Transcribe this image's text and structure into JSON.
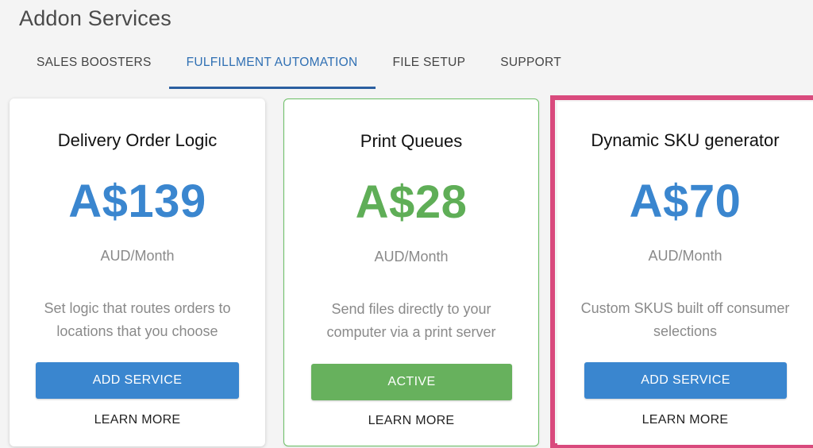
{
  "header": {
    "title": "Addon Services"
  },
  "tabs": [
    {
      "label": "SALES BOOSTERS",
      "active": false
    },
    {
      "label": "FULFILLMENT AUTOMATION",
      "active": true
    },
    {
      "label": "FILE SETUP",
      "active": false
    },
    {
      "label": "SUPPORT",
      "active": false
    }
  ],
  "cards": [
    {
      "title": "Delivery Order Logic",
      "price": "A$139",
      "unit": "AUD/Month",
      "description": "Set logic that routes orders to locations that you choose",
      "button_label": "ADD SERVICE",
      "learn_more": "LEARN MORE",
      "status": "available"
    },
    {
      "title": "Print Queues",
      "price": "A$28",
      "unit": "AUD/Month",
      "description": "Send files directly to your computer via a print server",
      "button_label": "ACTIVE",
      "learn_more": "LEARN MORE",
      "status": "active"
    },
    {
      "title": "Dynamic SKU generator",
      "price": "A$70",
      "unit": "AUD/Month",
      "description": "Custom SKUS built off consumer selections",
      "button_label": "ADD SERVICE",
      "learn_more": "LEARN MORE",
      "status": "available"
    }
  ],
  "colors": {
    "accent_blue": "#3a86cf",
    "active_green": "#67b15d",
    "highlight_pink": "#d94a7d",
    "tab_active": "#2f6fb3"
  }
}
